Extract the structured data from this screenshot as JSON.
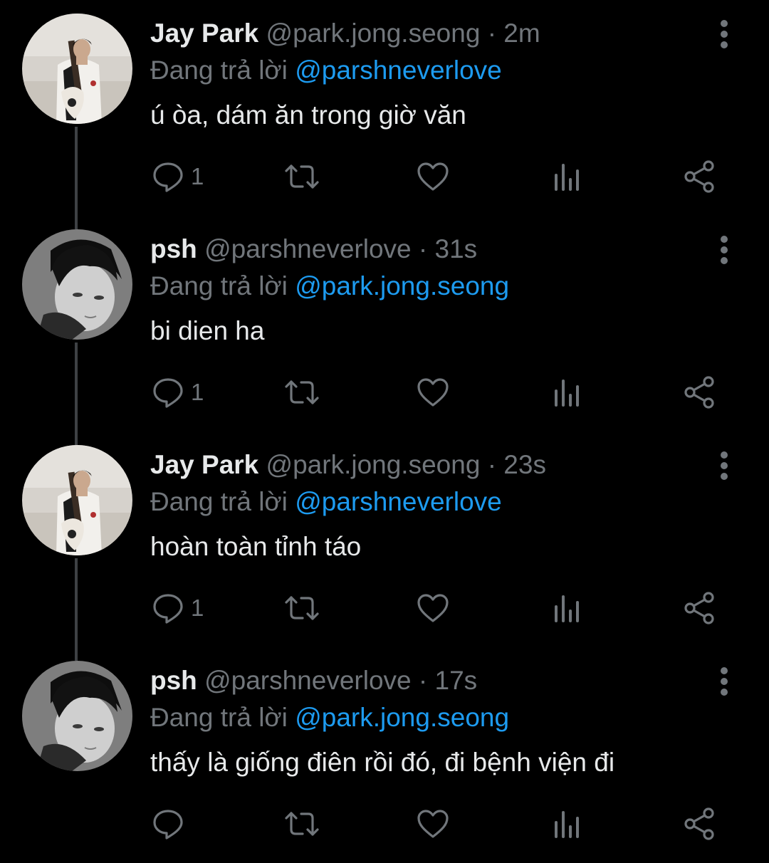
{
  "colors": {
    "background": "#000000",
    "primary_text": "#e7e9ea",
    "secondary_text": "#71767b",
    "mention": "#1d9bf0",
    "thread_line": "#3e4144"
  },
  "icons": [
    "reply-icon",
    "retweet-icon",
    "like-icon",
    "views-icon",
    "share-icon",
    "more-icon"
  ],
  "tweets": [
    {
      "name": "Jay Park",
      "handle": "@park.jong.seong",
      "separator": "·",
      "time": "2m",
      "reply_prefix": "Đang trả lời",
      "reply_to": "@parshneverlove",
      "text": "ú òa, dám ăn trong giờ văn",
      "reply_count": "1"
    },
    {
      "name": "psh",
      "handle": "@parshneverlove",
      "separator": "·",
      "time": "31s",
      "reply_prefix": "Đang trả lời",
      "reply_to": "@park.jong.seong",
      "text": "bi dien ha",
      "reply_count": "1"
    },
    {
      "name": "Jay Park",
      "handle": "@park.jong.seong",
      "separator": "·",
      "time": "23s",
      "reply_prefix": "Đang trả lời",
      "reply_to": "@parshneverlove",
      "text": "hoàn toàn tỉnh táo",
      "reply_count": "1"
    },
    {
      "name": "psh",
      "handle": "@parshneverlove",
      "separator": "·",
      "time": "17s",
      "reply_prefix": "Đang trả lời",
      "reply_to": "@park.jong.seong",
      "text": "thấy là giống điên rồi đó, đi bệnh viện đi",
      "reply_count": ""
    }
  ]
}
